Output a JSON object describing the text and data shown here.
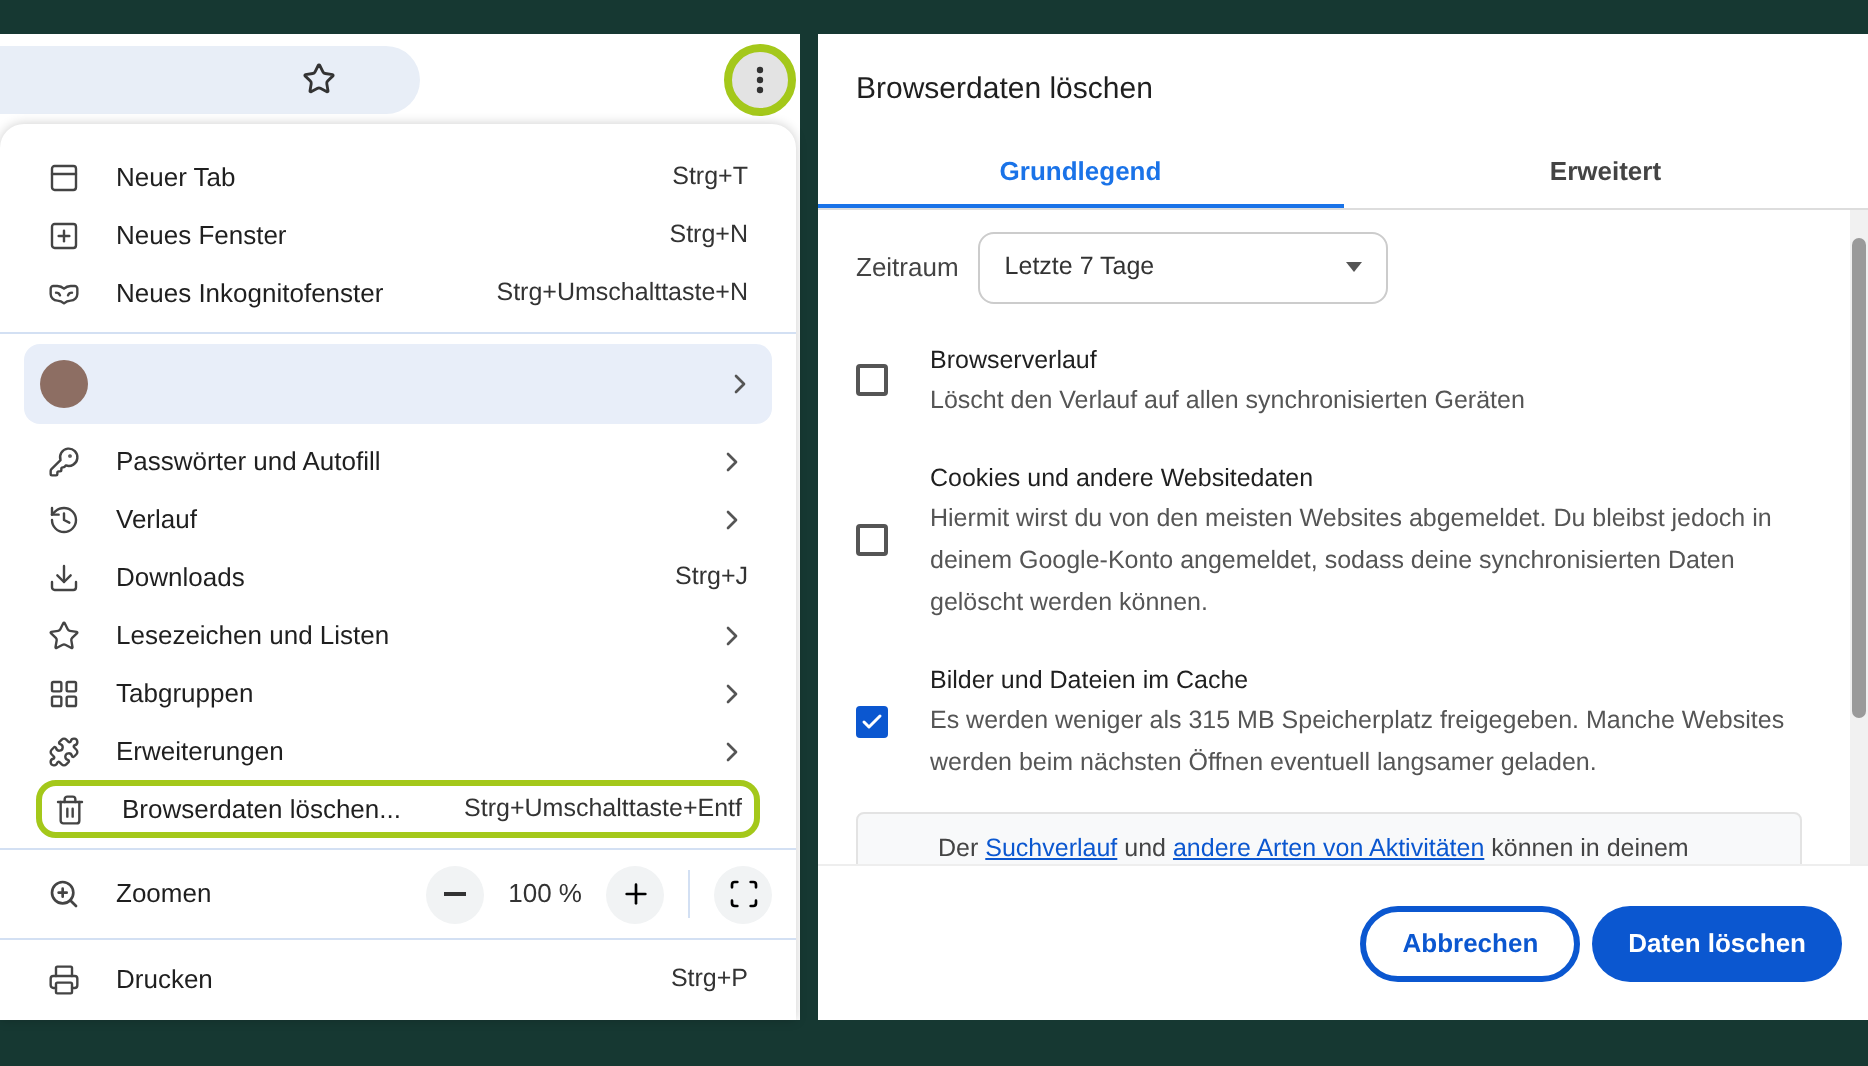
{
  "menu": {
    "items": [
      {
        "kind": "item",
        "label": "Neuer Tab",
        "shortcut": "Strg+T",
        "submenu": false,
        "highlighted": false
      },
      {
        "kind": "item",
        "label": "Neues Fenster",
        "shortcut": "Strg+N",
        "submenu": false,
        "highlighted": false
      },
      {
        "kind": "item",
        "label": "Neues Inkognitofenster",
        "shortcut": "Strg+Umschalttaste+N",
        "submenu": false,
        "highlighted": false
      },
      {
        "kind": "divider"
      },
      {
        "kind": "profile",
        "submenu": true
      },
      {
        "kind": "item",
        "label": "Passwörter und Autofill",
        "submenu": true,
        "highlighted": false
      },
      {
        "kind": "item",
        "label": "Verlauf",
        "submenu": true,
        "highlighted": false
      },
      {
        "kind": "item",
        "label": "Downloads",
        "shortcut": "Strg+J",
        "submenu": false,
        "highlighted": false
      },
      {
        "kind": "item",
        "label": "Lesezeichen und Listen",
        "submenu": true,
        "highlighted": false
      },
      {
        "kind": "item",
        "label": "Tabgruppen",
        "submenu": true,
        "highlighted": false
      },
      {
        "kind": "item",
        "label": "Erweiterungen",
        "submenu": true,
        "highlighted": false
      },
      {
        "kind": "item",
        "label": "Browserdaten löschen...",
        "shortcut": "Strg+Umschalttaste+Entf",
        "submenu": false,
        "highlighted": true
      },
      {
        "kind": "divider"
      },
      {
        "kind": "zoom",
        "label": "Zoomen",
        "value": "100 %"
      },
      {
        "kind": "divider"
      },
      {
        "kind": "item",
        "label": "Drucken",
        "shortcut": "Strg+P",
        "submenu": false,
        "highlighted": false
      }
    ]
  },
  "menu_button": {
    "highlighted": true
  },
  "dialog": {
    "title": "Browserdaten löschen",
    "tabs": [
      {
        "label": "Grundlegend",
        "selected": true
      },
      {
        "label": "Erweitert",
        "selected": false
      }
    ],
    "range": {
      "label": "Zeitraum",
      "value": "Letzte 7 Tage"
    },
    "options": [
      {
        "title": "Browserverlauf",
        "description": "Löscht den Verlauf auf allen synchronisierten Geräten",
        "checked": false
      },
      {
        "title": "Cookies und andere Websitedaten",
        "description": "Hiermit wirst du von den meisten Websites abgemeldet. Du bleibst jedoch in deinem Google-Konto angemeldet, sodass deine synchronisierten Daten gelöscht werden können.",
        "checked": false
      },
      {
        "title": "Bilder und Dateien im Cache",
        "description": "Es werden weniger als 315 MB Speicherplatz freigegeben. Manche Websites werden beim nächsten Öffnen eventuell langsamer geladen.",
        "checked": true
      }
    ],
    "info": {
      "text_1": "Der",
      "link_1": "Suchverlauf",
      "text_2": "und",
      "link_2": "andere Arten von Aktivitäten",
      "text_3": "können in deinem"
    },
    "buttons": [
      {
        "label": "Abbrechen",
        "kind": "secondary"
      },
      {
        "label": "Daten löschen",
        "kind": "primary"
      }
    ]
  }
}
